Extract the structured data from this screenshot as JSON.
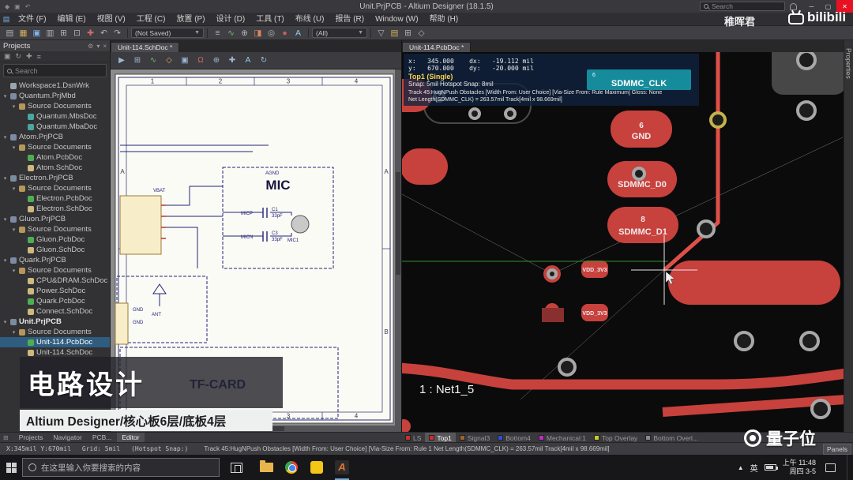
{
  "titlebar": {
    "title": "Unit.PrjPCB - Altium Designer (18.1.5)",
    "search_placeholder": "Search",
    "buttons": {
      "minimize": "─",
      "maximize": "▢",
      "close": "✕"
    }
  },
  "watermarks": {
    "top_name": "稚晖君",
    "top_logo": "bilibili",
    "bottom_logo": "量子位"
  },
  "menubar": {
    "items": [
      "文件 (F)",
      "编辑 (E)",
      "视图 (V)",
      "工程 (C)",
      "放置 (P)",
      "设计 (D)",
      "工具 (T)",
      "布线 (U)",
      "报告 (R)",
      "Window (W)",
      "帮助 (H)"
    ]
  },
  "toolbar": {
    "icons_a": [
      {
        "name": "new-doc-icon",
        "glyph": "▤"
      },
      {
        "name": "open-icon",
        "glyph": "▦",
        "color": "#d8b25a"
      },
      {
        "name": "save-icon",
        "glyph": "▣",
        "color": "#7fb3e8"
      },
      {
        "name": "print-icon",
        "glyph": "▥"
      },
      {
        "name": "zoom-fit-icon",
        "glyph": "⊞"
      },
      {
        "name": "zoom-area-icon",
        "glyph": "⊡"
      },
      {
        "name": "cross-probe-icon",
        "glyph": "✚",
        "color": "#d36a6a"
      },
      {
        "name": "undo-icon",
        "glyph": "↶"
      },
      {
        "name": "redo-icon",
        "glyph": "↷"
      }
    ],
    "not_saved_label": "(Not Saved)",
    "icons_b": [
      {
        "name": "align-icon",
        "glyph": "≡"
      },
      {
        "name": "wire-icon",
        "glyph": "∿",
        "color": "#6fc06f"
      },
      {
        "name": "net-icon",
        "glyph": "⊕"
      },
      {
        "name": "route-icon",
        "glyph": "◨",
        "color": "#d8885a"
      },
      {
        "name": "via-icon",
        "glyph": "◎"
      },
      {
        "name": "pad-icon",
        "glyph": "●",
        "color": "#c95f5f"
      },
      {
        "name": "string-icon",
        "glyph": "A",
        "color": "#8fd0e8"
      }
    ],
    "all_label": "(All)",
    "icons_c": [
      {
        "name": "filter-icon",
        "glyph": "▽"
      },
      {
        "name": "layers-icon",
        "glyph": "▤",
        "color": "#d8b25a"
      },
      {
        "name": "grid-icon",
        "glyph": "⊞"
      },
      {
        "name": "measure-icon",
        "glyph": "◇"
      }
    ]
  },
  "projects_panel": {
    "title": "Projects",
    "header_icons": [
      {
        "name": "settings-icon",
        "glyph": "⚙"
      },
      {
        "name": "dropdown-icon",
        "glyph": "▾"
      },
      {
        "name": "close-icon",
        "glyph": "×"
      }
    ],
    "toolbar_icons": [
      {
        "name": "save-all-icon",
        "glyph": "▣"
      },
      {
        "name": "refresh-icon",
        "glyph": "↻"
      },
      {
        "name": "add-icon",
        "glyph": "✚"
      },
      {
        "name": "list-icon",
        "glyph": "≡"
      }
    ],
    "search_placeholder": "Search",
    "tree": [
      {
        "label": "Workspace1.DsnWrk",
        "level": 0,
        "iconColor": "#9aa7b0",
        "arrow": false,
        "name": "tree-item-workspace"
      },
      {
        "label": "Quantum.PrjMbd",
        "level": 0,
        "iconColor": "#7d8ba1",
        "name": "tree-item-project"
      },
      {
        "label": "Source Documents",
        "level": 1,
        "iconColor": "#b5975a",
        "name": "tree-item-folder"
      },
      {
        "label": "Quantum.MbsDoc",
        "level": 2,
        "iconColor": "#49a6a0",
        "arrow": false,
        "name": "tree-item-doc"
      },
      {
        "label": "Quantum.MbaDoc",
        "level": 2,
        "iconColor": "#49a6a0",
        "arrow": false,
        "name": "tree-item-doc"
      },
      {
        "label": "Atom.PrjPCB",
        "level": 0,
        "iconColor": "#7d8ba1",
        "name": "tree-item-project"
      },
      {
        "label": "Source Documents",
        "level": 1,
        "iconColor": "#b5975a",
        "name": "tree-item-folder"
      },
      {
        "label": "Atom.PcbDoc",
        "level": 2,
        "iconColor": "#4fae54",
        "arrow": false,
        "name": "tree-item-doc"
      },
      {
        "label": "Atom.SchDoc",
        "level": 2,
        "iconColor": "#cdb97e",
        "arrow": false,
        "name": "tree-item-doc"
      },
      {
        "label": "Electron.PrjPCB",
        "level": 0,
        "iconColor": "#7d8ba1",
        "name": "tree-item-project"
      },
      {
        "label": "Source Documents",
        "level": 1,
        "iconColor": "#b5975a",
        "name": "tree-item-folder"
      },
      {
        "label": "Electron.PcbDoc",
        "level": 2,
        "iconColor": "#4fae54",
        "arrow": false,
        "name": "tree-item-doc"
      },
      {
        "label": "Electron.SchDoc",
        "level": 2,
        "iconColor": "#cdb97e",
        "arrow": false,
        "name": "tree-item-doc"
      },
      {
        "label": "Gluon.PrjPCB",
        "level": 0,
        "iconColor": "#7d8ba1",
        "name": "tree-item-project"
      },
      {
        "label": "Source Documents",
        "level": 1,
        "iconColor": "#b5975a",
        "name": "tree-item-folder"
      },
      {
        "label": "Gluon.PcbDoc",
        "level": 2,
        "iconColor": "#4fae54",
        "arrow": false,
        "name": "tree-item-doc"
      },
      {
        "label": "Gluon.SchDoc",
        "level": 2,
        "iconColor": "#cdb97e",
        "arrow": false,
        "name": "tree-item-doc"
      },
      {
        "label": "Quark.PrjPCB",
        "level": 0,
        "iconColor": "#7d8ba1",
        "name": "tree-item-project"
      },
      {
        "label": "Source Documents",
        "level": 1,
        "iconColor": "#b5975a",
        "name": "tree-item-folder"
      },
      {
        "label": "CPU&DRAM.SchDoc",
        "level": 2,
        "iconColor": "#cdb97e",
        "arrow": false,
        "name": "tree-item-doc"
      },
      {
        "label": "Power.SchDoc",
        "level": 2,
        "iconColor": "#cdb97e",
        "arrow": false,
        "name": "tree-item-doc"
      },
      {
        "label": "Quark.PcbDoc",
        "level": 2,
        "iconColor": "#4fae54",
        "arrow": false,
        "name": "tree-item-doc"
      },
      {
        "label": "Connect.SchDoc",
        "level": 2,
        "iconColor": "#cdb97e",
        "arrow": false,
        "name": "tree-item-doc"
      },
      {
        "label": "Unit.PrjPCB",
        "level": 0,
        "iconColor": "#7d8ba1",
        "bold": true,
        "name": "tree-item-project"
      },
      {
        "label": "Source Documents",
        "level": 1,
        "iconColor": "#b5975a",
        "name": "tree-item-folder"
      },
      {
        "label": "Unit-114.PcbDoc",
        "level": 2,
        "iconColor": "#4fae54",
        "arrow": false,
        "selected": true,
        "name": "tree-item-doc"
      },
      {
        "label": "Unit-114.SchDoc",
        "level": 2,
        "iconColor": "#cdb97e",
        "arrow": false,
        "name": "tree-item-doc"
      }
    ]
  },
  "schematic": {
    "tab": "Unit-114.SchDoc *",
    "toolbar_icons": [
      {
        "name": "cursor-icon",
        "glyph": "▶"
      },
      {
        "name": "grid-icon",
        "glyph": "⊞"
      },
      {
        "name": "wire-icon",
        "glyph": "∿",
        "color": "#6fc06f"
      },
      {
        "name": "part-icon",
        "glyph": "◇",
        "color": "#d8b25a"
      },
      {
        "name": "sheet-icon",
        "glyph": "▣"
      },
      {
        "name": "power-icon",
        "glyph": "Ω",
        "color": "#d36a6a"
      },
      {
        "name": "net-label-icon",
        "glyph": "⊕"
      },
      {
        "name": "place-icon",
        "glyph": "✚"
      },
      {
        "name": "text-icon",
        "glyph": "A",
        "color": "#8fd0e8"
      },
      {
        "name": "refresh-icon",
        "glyph": "↻"
      }
    ],
    "sheet": {
      "columns": [
        "1",
        "2",
        "3",
        "4"
      ],
      "rows": [
        "A",
        "B"
      ],
      "mic_title": "MIC",
      "tfcard_title": "TF-CARD",
      "labels": {
        "vbat": "VBAT",
        "agnd": "AGND",
        "c1": "C1",
        "c1_val": "33pF",
        "c3": "C3",
        "c3_val": "33pF",
        "mic_ref": "MIC1",
        "micp": "MICP",
        "micn": "MICN",
        "ant": "ANT",
        "gnd1": "GND",
        "gnd2": "GND"
      }
    }
  },
  "pcb": {
    "tab": "Unit-114.PcbDoc *",
    "properties_tab": "Properties",
    "hud": {
      "x_line": "x:   345.000    dx:   -19.112 mil",
      "y_line": "y:   670.000    dy:   -20.000 mil",
      "layer": "Top1 (Single)",
      "snap": "Snap: 5mil Hotspot Snap: 8mil",
      "track": "Track 45:HugNPush Obstacles [Width From: User Choice] [Via-Size From: Rule Maximum] Gloss: None",
      "net": "Net Length(SDMMC_CLK) = 263.57mil Track[4mil x 98.669mil]"
    },
    "net_tip": {
      "pin": "6",
      "net": "SDMMC_CLK"
    },
    "pads": {
      "gnd_num": "6",
      "gnd": "GND",
      "d0": "SDMMC_D0",
      "d1_num": "8",
      "d1": "SDMMC_D1",
      "vdd_a": "VDD_3V3",
      "vdd_b": "VDD_3V3",
      "net_indicator": "1 : Net1_5"
    },
    "colors": {
      "pad_red": "#c7413d",
      "active_trace": "#e05048",
      "net_tip_teal": "#1795a5",
      "hud_yellow": "#ffd34d",
      "guide_green": "#2f8f2f"
    }
  },
  "layer_bar": {
    "tabs": [
      {
        "label": "LS",
        "swatch": "#cf2e2e"
      },
      {
        "label": "Top1",
        "swatch": "#cf2e2e",
        "active": true
      },
      {
        "label": "Signal3",
        "swatch": "#a0622d"
      },
      {
        "label": "Bottom4",
        "swatch": "#2d4fd0"
      },
      {
        "label": "Mechanical:1",
        "swatch": "#c02dc0"
      },
      {
        "label": "Top Overlay",
        "swatch": "#c8c82d"
      },
      {
        "label": "Bottom Overl...",
        "swatch": "#8a8a8a"
      }
    ]
  },
  "bottom_bar": {
    "tabs": [
      {
        "label": "Projects"
      },
      {
        "label": "Navigator"
      },
      {
        "label": "PCB..."
      },
      {
        "label": "Editor",
        "active": true
      }
    ],
    "status_xy": "X:345mil Y:670mil",
    "status_grid": "Grid: 5mil",
    "status_snap": "(Hotspot Snap:)",
    "status_right": "Track 45:HugNPush Obstacles [Width From: User Choice] [Via-Size From: Rule 1 Net Length(SDMMC_CLK) = 263.57mil Track[4mil x 98.669mil]",
    "panels_button": "Panels"
  },
  "caption": {
    "title": "电路设计",
    "subtitle": "Altium Designer/核心板6层/底板4层"
  },
  "taskbar": {
    "search_placeholder": "在这里输入你要搜索的内容",
    "lang_indicator": "英",
    "time": "上午 11:48",
    "date": "周四 3-5"
  }
}
